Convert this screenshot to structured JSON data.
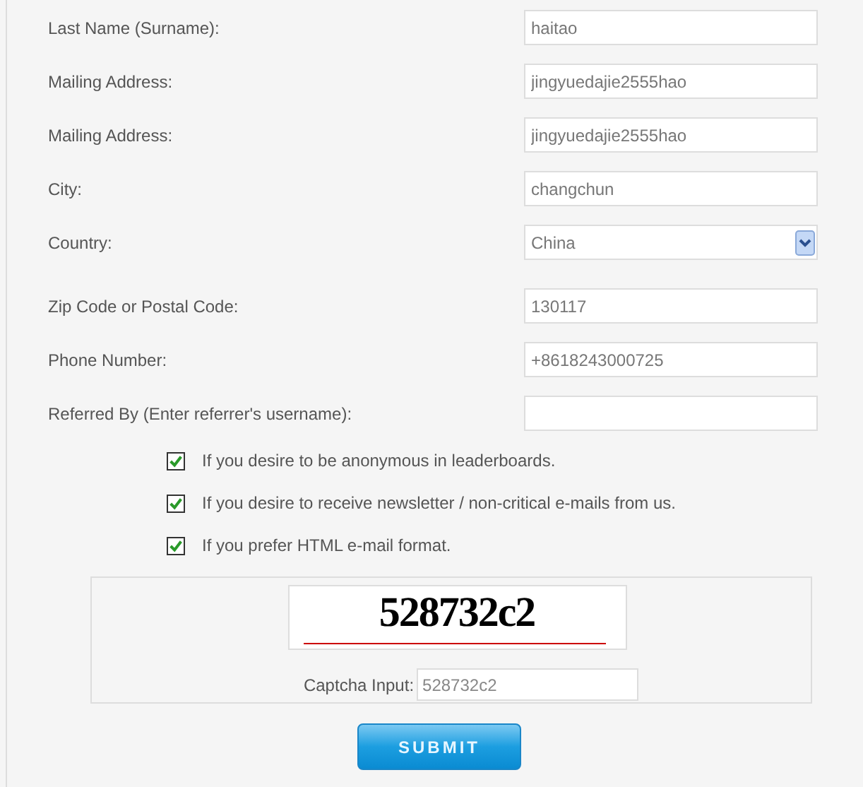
{
  "fields": [
    {
      "kind": "text",
      "label": "Last Name (Surname):",
      "value": "haitao"
    },
    {
      "kind": "text",
      "label": "Mailing Address:",
      "value": "jingyuedajie2555hao"
    },
    {
      "kind": "text",
      "label": "Mailing Address:",
      "value": "jingyuedajie2555hao"
    },
    {
      "kind": "text",
      "label": "City:",
      "value": "changchun"
    },
    {
      "kind": "select",
      "label": "Country:",
      "value": "China"
    },
    {
      "kind": "text",
      "label": "Zip Code or Postal Code:",
      "value": "130117"
    },
    {
      "kind": "text",
      "label": "Phone Number:",
      "value": "+8618243000725"
    },
    {
      "kind": "text",
      "label": "Referred By (Enter referrer's username):"
    }
  ],
  "options": [
    {
      "label": "If you desire to be anonymous in leaderboards.",
      "checked": true
    },
    {
      "label": "If you desire to receive newsletter / non-critical e-mails from us.",
      "checked": true
    },
    {
      "label": "If you prefer HTML e-mail format.",
      "checked": true
    }
  ],
  "captcha": {
    "image_text": "528732c2",
    "label": "Captcha Input:",
    "value": "528732c2"
  },
  "submit": "SUBMIT"
}
